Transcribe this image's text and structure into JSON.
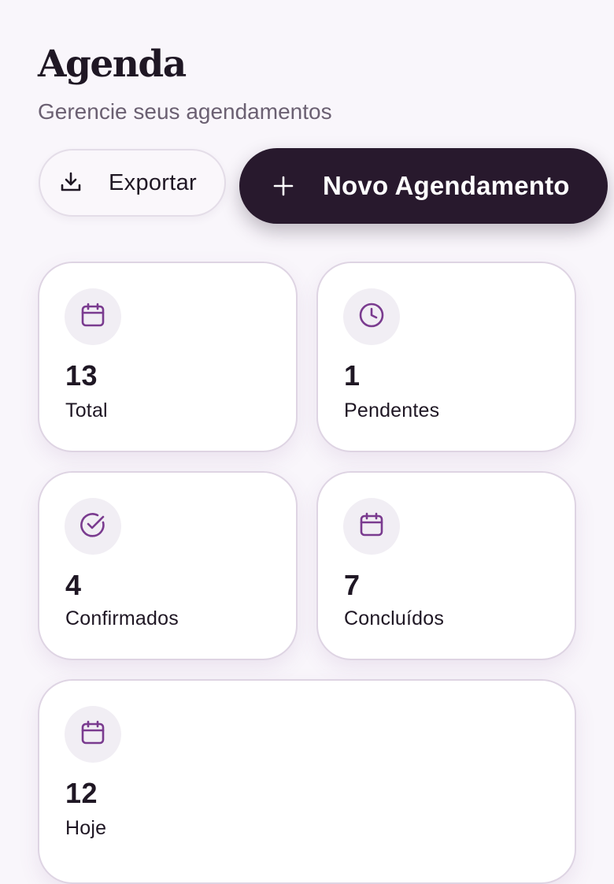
{
  "header": {
    "title": "Agenda",
    "subtitle": "Gerencie seus agendamentos"
  },
  "actions": {
    "export_label": "Exportar",
    "export_icon": "download-icon",
    "new_label": "Novo Agendamento",
    "new_icon": "plus-icon"
  },
  "stats": [
    {
      "value": "13",
      "label": "Total",
      "icon": "calendar-icon"
    },
    {
      "value": "1",
      "label": "Pendentes",
      "icon": "clock-icon"
    },
    {
      "value": "4",
      "label": "Confirmados",
      "icon": "check-circle-icon"
    },
    {
      "value": "7",
      "label": "Concluídos",
      "icon": "calendar-icon"
    },
    {
      "value": "12",
      "label": "Hoje",
      "icon": "calendar-icon"
    }
  ],
  "colors": {
    "background": "#f9f6fb",
    "primary_dark": "#28192d",
    "icon_purple": "#7a3b8f",
    "icon_bg": "#f1eef4",
    "card_border": "#ded4e3"
  }
}
